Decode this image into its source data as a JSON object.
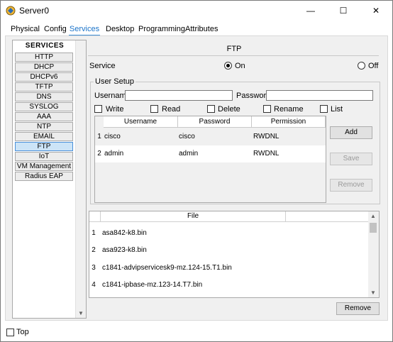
{
  "window": {
    "title": "Server0",
    "min": "—",
    "max": "☐",
    "close": "✕"
  },
  "tabs": [
    {
      "label": "Physical",
      "active": false
    },
    {
      "label": "Config",
      "active": false
    },
    {
      "label": "Services",
      "active": true
    },
    {
      "label": "Desktop",
      "active": false
    },
    {
      "label": "Programming",
      "active": false
    },
    {
      "label": "Attributes",
      "active": false
    }
  ],
  "services": {
    "header": "SERVICES",
    "items": [
      "HTTP",
      "DHCP",
      "DHCPv6",
      "TFTP",
      "DNS",
      "SYSLOG",
      "AAA",
      "NTP",
      "EMAIL",
      "FTP",
      "IoT",
      "VM Management",
      "Radius EAP"
    ],
    "selected": "FTP"
  },
  "ftp": {
    "title": "FTP",
    "service_label": "Service",
    "on_label": "On",
    "off_label": "Off",
    "service_state": "on",
    "user_setup": {
      "label": "User Setup",
      "username_label": "Username",
      "password_label": "Password",
      "username_value": "",
      "password_value": "",
      "permissions": [
        {
          "label": "Write",
          "checked": false
        },
        {
          "label": "Read",
          "checked": false
        },
        {
          "label": "Delete",
          "checked": false
        },
        {
          "label": "Rename",
          "checked": false
        },
        {
          "label": "List",
          "checked": false
        }
      ],
      "columns": [
        "Username",
        "Password",
        "Permission"
      ],
      "rows": [
        {
          "num": "1",
          "username": "cisco",
          "password": "cisco",
          "permission": "RWDNL"
        },
        {
          "num": "2",
          "username": "admin",
          "password": "admin",
          "permission": "RWDNL"
        }
      ],
      "add_label": "Add",
      "save_label": "Save",
      "remove_label": "Remove"
    },
    "files": {
      "column": "File",
      "rows": [
        {
          "num": "1",
          "name": "asa842-k8.bin"
        },
        {
          "num": "2",
          "name": "asa923-k8.bin"
        },
        {
          "num": "3",
          "name": "c1841-advipservicesk9-mz.124-15.T1.bin"
        },
        {
          "num": "4",
          "name": "c1841-ipbase-mz.123-14.T7.bin"
        }
      ],
      "remove_label": "Remove"
    }
  },
  "footer": {
    "top_label": "Top",
    "top_checked": false
  },
  "colors": {
    "accent": "#1a73c9",
    "selected_bg": "#cce4f7",
    "panel_bg": "#f0f0f0"
  }
}
